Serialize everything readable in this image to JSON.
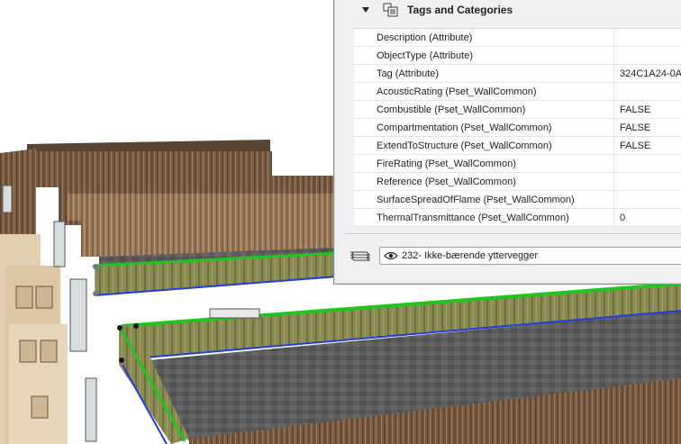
{
  "panel": {
    "section_title": "Tags and Categories",
    "properties": [
      {
        "name": "Description (Attribute)",
        "value": ""
      },
      {
        "name": "ObjectType (Attribute)",
        "value": ""
      },
      {
        "name": "Tag (Attribute)",
        "value": "324C1A24-0A"
      },
      {
        "name": "AcousticRating (Pset_WallCommon)",
        "value": ""
      },
      {
        "name": "Combustible (Pset_WallCommon)",
        "value": "FALSE"
      },
      {
        "name": "Compartmentation (Pset_WallCommon)",
        "value": "FALSE"
      },
      {
        "name": "ExtendToStructure (Pset_WallCommon)",
        "value": "FALSE"
      },
      {
        "name": "FireRating (Pset_WallCommon)",
        "value": ""
      },
      {
        "name": "Reference (Pset_WallCommon)",
        "value": ""
      },
      {
        "name": "SurfaceSpreadOfFlame (Pset_WallCommon)",
        "value": ""
      },
      {
        "name": "ThermalTransmittance (Pset_WallCommon)",
        "value": "0"
      }
    ],
    "layer": {
      "name": "232- Ikke-bærende yttervegger"
    }
  },
  "icons": {
    "collapse": "triangle-down-icon",
    "tags": "tags-categories-icon",
    "layers": "layers-icon",
    "visibility": "eye-icon"
  },
  "colors": {
    "selection_green": "#22c422",
    "selection_blue": "#1f3fd8",
    "wall_wood": "#7a5a3e",
    "roof_gray": "#5a5a5a",
    "panel_bg": "#f0f0f0"
  }
}
